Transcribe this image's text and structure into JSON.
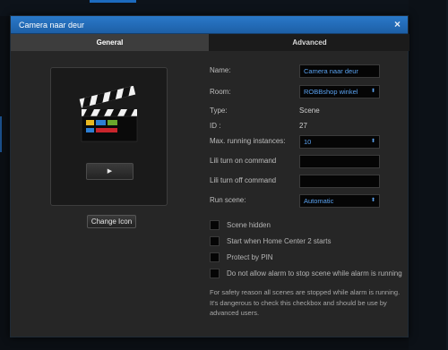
{
  "dialog": {
    "title": "Camera naar deur",
    "close_symbol": "×"
  },
  "tabs": [
    {
      "label": "General",
      "active": true
    },
    {
      "label": "Advanced",
      "active": false
    }
  ],
  "icon_panel": {
    "icon_name": "clapperboard-icon",
    "play_symbol": "▶",
    "change_icon_label": "Change Icon"
  },
  "form": {
    "name": {
      "label": "Name:",
      "value": "Camera naar deur"
    },
    "room": {
      "label": "Room:",
      "value": "ROBBshop winkel"
    },
    "type": {
      "label": "Type:",
      "value": "Scene"
    },
    "id": {
      "label": "ID :",
      "value": "27"
    },
    "max_instances": {
      "label": "Max. running instances:",
      "value": "10"
    },
    "lili_on": {
      "label": "Lili turn on command",
      "value": ""
    },
    "lili_off": {
      "label": "Lili turn off command",
      "value": ""
    },
    "run_scene": {
      "label": "Run scene:",
      "value": "Automatic"
    },
    "select_arrow": "⬍"
  },
  "checkboxes": [
    {
      "label": "Scene hidden",
      "checked": false
    },
    {
      "label": "Start when Home Center 2 starts",
      "checked": false
    },
    {
      "label": "Protect by PIN",
      "checked": false
    },
    {
      "label": "Do not allow alarm to stop scene while alarm is running",
      "checked": false
    }
  ],
  "note": "For safety reason all scenes are stopped while alarm is running. It's dangerous to check this checkbox and should be use by advanced users.",
  "colors": {
    "titlebar": "#2a79c9",
    "field_text": "#5aa2f0",
    "panel_bg": "#262626"
  }
}
